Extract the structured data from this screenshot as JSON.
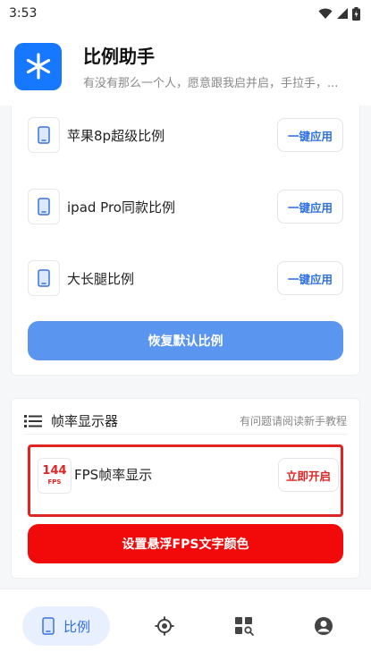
{
  "status_bar": {
    "time": "3:53"
  },
  "header": {
    "title": "比例助手",
    "subtitle": "有没有那么一个人，愿意跟我启并启，手拉手，..."
  },
  "ratio_card": {
    "items": [
      {
        "label": "苹果8p超级比例",
        "button": "一键应用"
      },
      {
        "label": "ipad Pro同款比例",
        "button": "一键应用"
      },
      {
        "label": "大长腿比例",
        "button": "一键应用"
      }
    ],
    "restore_button": "恢复默认比例"
  },
  "fps_card": {
    "title": "帧率显示器",
    "help_link": "有问题请阅读新手教程",
    "item": {
      "logo_number": "144",
      "logo_text": "FPS",
      "label": "FPS帧率显示",
      "button": "立即开启"
    },
    "color_button": "设置悬浮FPS文字颜色"
  },
  "bottom_nav": {
    "items": [
      {
        "label": "比例",
        "icon": "phone-icon",
        "active": true
      },
      {
        "label": "",
        "icon": "crosshair-icon",
        "active": false
      },
      {
        "label": "",
        "icon": "grid-search-icon",
        "active": false
      },
      {
        "label": "",
        "icon": "user-icon",
        "active": false
      }
    ]
  },
  "colors": {
    "primary": "#2f6fe0",
    "restore": "#5a95f0",
    "danger": "#f20a0a",
    "logo": "#1677ff"
  }
}
